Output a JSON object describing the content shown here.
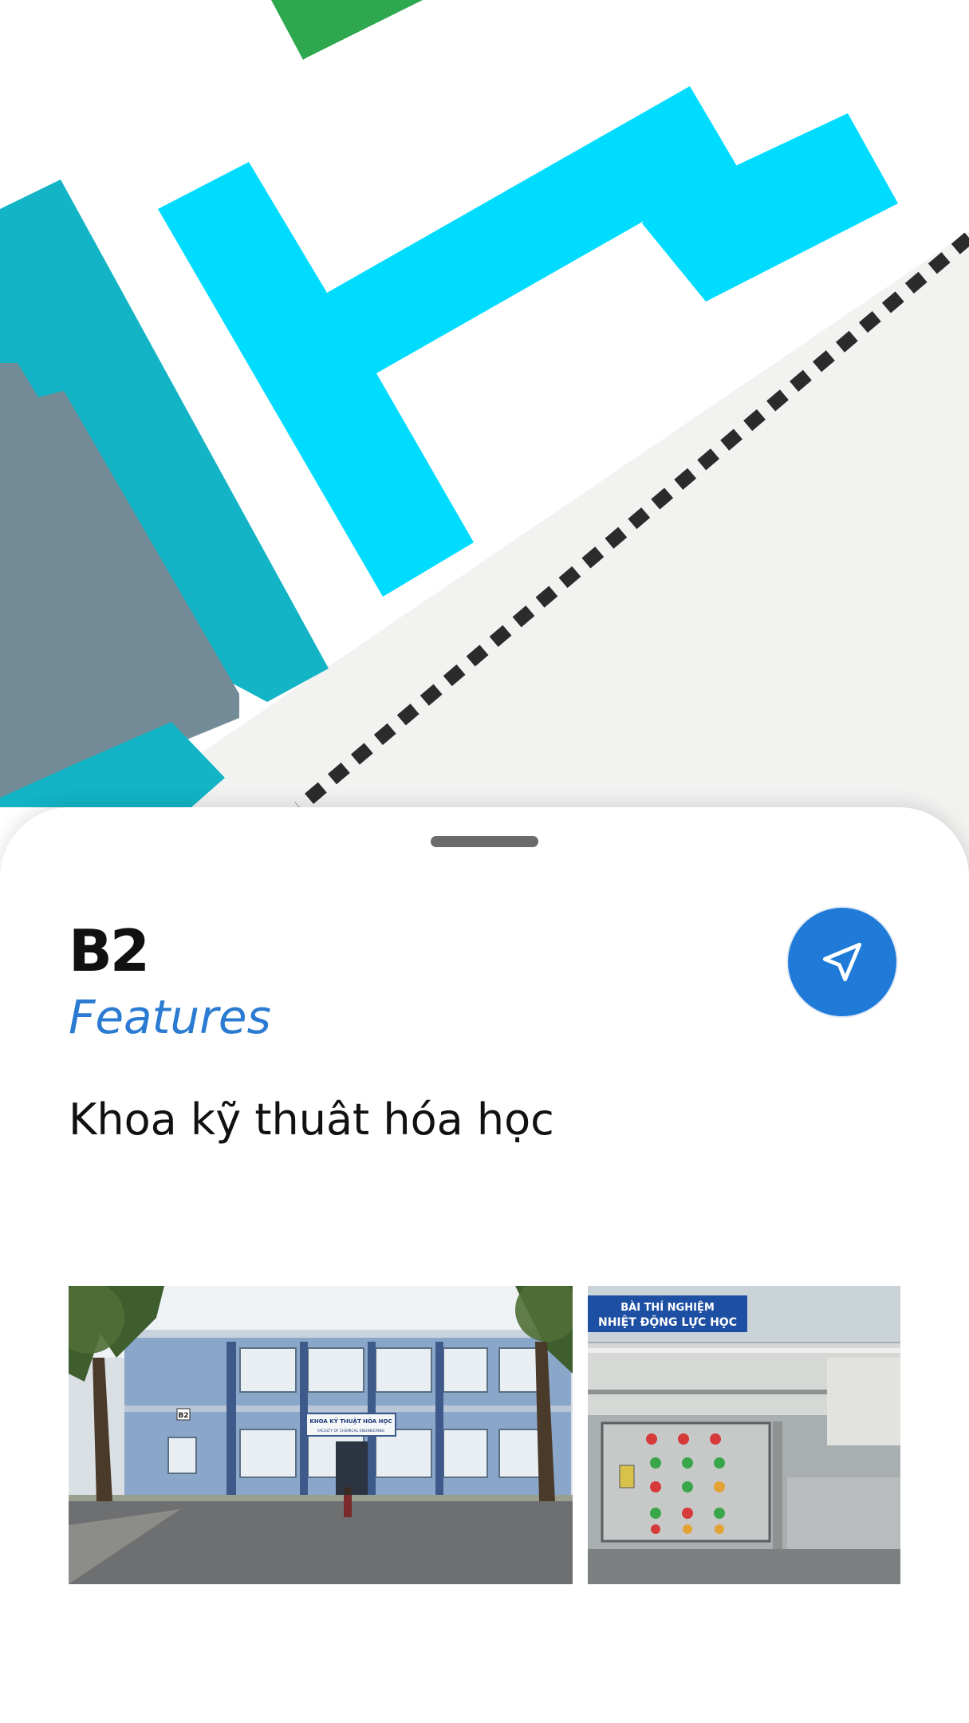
{
  "building": {
    "code": "B2",
    "category": "Features",
    "description": "Khoa kỹ thuât hóa học"
  },
  "photos": [
    {
      "subject": "building-exterior",
      "building_number_label": "B2",
      "sign_label": "KHOA KỸ THUẬT HÓA HỌC",
      "sign_sublabel": "FACULTY OF CHEMICAL ENGINEERING"
    },
    {
      "subject": "lab-equipment",
      "sign_line1": "BÀI THÍ NGHIỆM",
      "sign_line2": "NHIỆT ĐỘNG LỰC HỌC"
    }
  ],
  "icons": {
    "navigate": "navigation-arrow-icon",
    "handle": "drag-handle"
  },
  "colors": {
    "accent": "#1f7ad8",
    "subtitle": "#2a7bd1",
    "building_cyan": "#00dcff",
    "building_teal": "#12b4c6",
    "building_gray": "#748c98",
    "park_green": "#2ea84f",
    "railway": "#2b2b2b",
    "ground": "#f2f2f1"
  }
}
